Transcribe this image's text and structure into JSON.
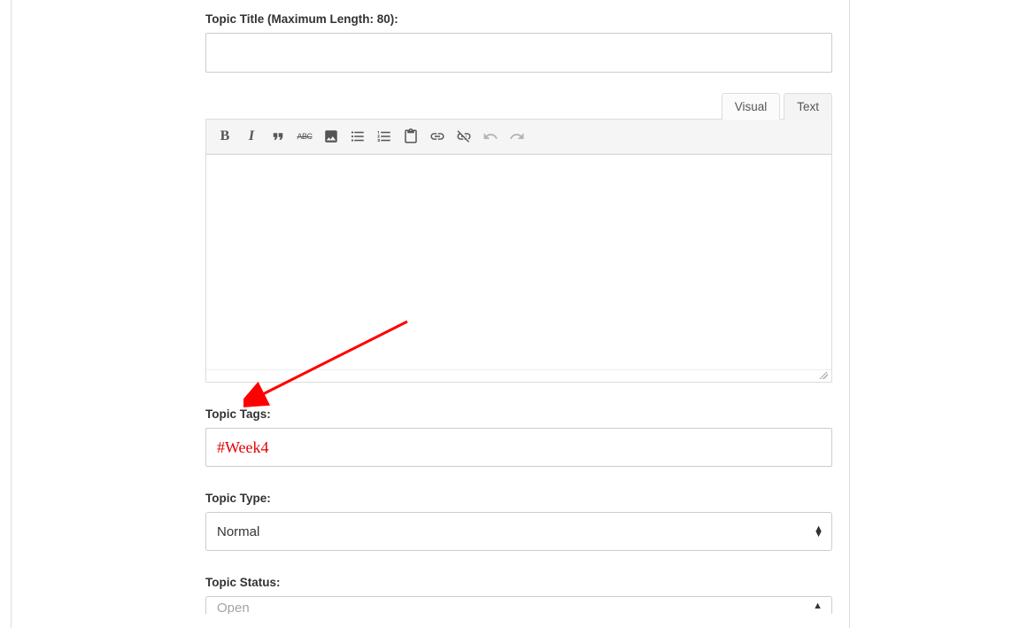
{
  "labels": {
    "topic_title": "Topic Title (Maximum Length: 80):",
    "topic_tags": "Topic Tags:",
    "topic_type": "Topic Type:",
    "topic_status": "Topic Status:"
  },
  "tabs": {
    "visual": "Visual",
    "text": "Text"
  },
  "fields": {
    "title_value": "",
    "tags_value": "#Week4",
    "type_value": "Normal",
    "status_value": "Open"
  },
  "toolbar": {
    "bold": "B",
    "italic": "I",
    "abc": "ABC"
  }
}
